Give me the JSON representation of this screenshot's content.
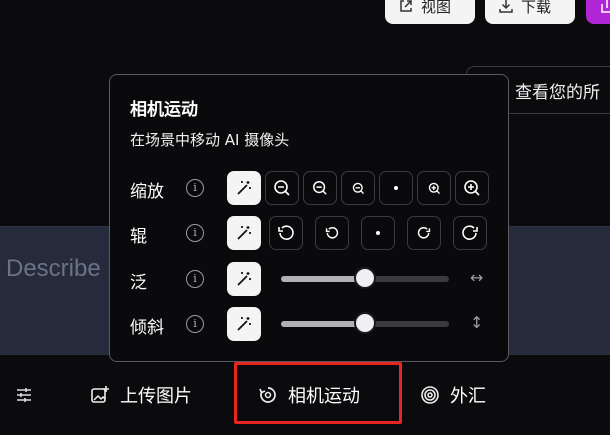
{
  "top": {
    "view_label": "视图",
    "download_label": "下载",
    "history_label": "查看您的所"
  },
  "prompt": {
    "placeholder": "Describe"
  },
  "toolbar": {
    "upload_label": "上传图片",
    "camera_label": "相机运动",
    "outpaint_label": "外汇"
  },
  "camera_panel": {
    "title": "相机运动",
    "subtitle": "在场景中移动 AI 摄像头",
    "zoom_label": "缩放",
    "roll_label": "辊",
    "pan_label": "泛",
    "tilt_label": "倾斜",
    "info_glyph": "i",
    "pan_value": 0.5,
    "tilt_value": 0.5,
    "pan_end_icon": "↔",
    "tilt_end_icon": "↕"
  },
  "colors": {
    "highlight": "#e8251f",
    "purple": "#b026d6",
    "panel_bg": "#0a0a0c",
    "prompt_bg": "#252b3a"
  }
}
